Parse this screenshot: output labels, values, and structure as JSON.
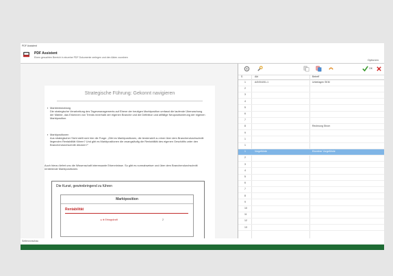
{
  "window": {
    "title": "PDF Assistent"
  },
  "header": {
    "title": "PDF Assistent",
    "subtitle": "Einen gesuchten Bereich in einzelne PDF Dokumente zerlegen und den Akten zuordnen",
    "options_label": "Optionen"
  },
  "document": {
    "title": "Strategische Führung: Gekonnt navigieren",
    "bullets": [
      {
        "heading": "Marktentwicklung",
        "text": "Die strategische Verarbeitung des Tagesmanagements auf Ebene der heutigen Marktposition umfasst die laufende Überwachung der Märkte, das Erkennen von Trends innerhalb der eigenen Branche und die Definition und affällige Neupositionierung der eigenen Marktposition."
      },
      {
        "heading": "Marktpositionen",
        "text": "Aus strategischer Sicht stellt sich hier die Frage: „Gibt es Marktpositionen, die tendenziell zu einer über dem Branchendurchschnitt liegenden Rentabilität führen? Und gibt es Marktpositionen die zwangsläufig die Rentabilität des eigenen Geschäfts unter den Branchendurchschnitt drücken?“"
      }
    ],
    "closing": "Auch hierzu liefert uns die Wissenschaft interessante Erkenntnisse. So gibt es normabweiser und über dem Branchendurchschnitt rentierende Marktpositionen.",
    "box": {
      "title": "Die Kunst, gewinnbringend zu führen",
      "inner_title": "Marktposition",
      "row_label": "Rentabilität",
      "sub_label": "Ertragskraft",
      "sub_value": "2"
    }
  },
  "right_panel": {
    "toolbar": {
      "icons": [
        "gear-icon",
        "wrench-icon",
        "copy-icon",
        "copy-red-icon",
        "undo-icon",
        "check-icon",
        "close-icon"
      ],
      "ok_label": "OK"
    },
    "columns": [
      "S",
      "Akt",
      "Betreff"
    ],
    "rows": [
      {
        "n": "1",
        "akt": "A/0/004/51-1",
        "betreff": "Unterlagen SKM"
      },
      {
        "n": "2",
        "akt": "",
        "betreff": ""
      },
      {
        "n": "3",
        "akt": "",
        "betreff": ""
      },
      {
        "n": "4",
        "akt": "",
        "betreff": ""
      },
      {
        "n": "5",
        "akt": "",
        "betreff": ""
      },
      {
        "n": "6",
        "akt": "",
        "betreff": ""
      },
      {
        "n": "7",
        "akt": "",
        "betreff": ""
      },
      {
        "n": "8",
        "akt": "",
        "betreff": "Rechnung Strom"
      },
      {
        "n": "9",
        "akt": "",
        "betreff": ""
      },
      {
        "n": "1",
        "akt": "",
        "betreff": ""
      },
      {
        "n": "1",
        "akt": "",
        "betreff": ""
      },
      {
        "n": "1",
        "akt": "Vorgeführte",
        "betreff": "Einzelner Vorgeführte",
        "selected": true
      },
      {
        "n": "2",
        "akt": "",
        "betreff": ""
      },
      {
        "n": "3",
        "akt": "",
        "betreff": ""
      },
      {
        "n": "4",
        "akt": "",
        "betreff": ""
      },
      {
        "n": "5",
        "akt": "",
        "betreff": ""
      },
      {
        "n": "6",
        "akt": "",
        "betreff": ""
      },
      {
        "n": "7",
        "akt": "",
        "betreff": ""
      },
      {
        "n": "8",
        "akt": "",
        "betreff": ""
      },
      {
        "n": "9",
        "akt": "",
        "betreff": ""
      },
      {
        "n": "10",
        "akt": "",
        "betreff": ""
      },
      {
        "n": "11",
        "akt": "",
        "betreff": ""
      },
      {
        "n": "12",
        "akt": "",
        "betreff": ""
      },
      {
        "n": "13",
        "akt": "",
        "betreff": ""
      }
    ]
  },
  "status": {
    "text": "Seitenvorschau"
  },
  "colors": {
    "accent_green": "#1e6b34",
    "selection": "#7fb5e6",
    "red": "#c12a2a"
  }
}
